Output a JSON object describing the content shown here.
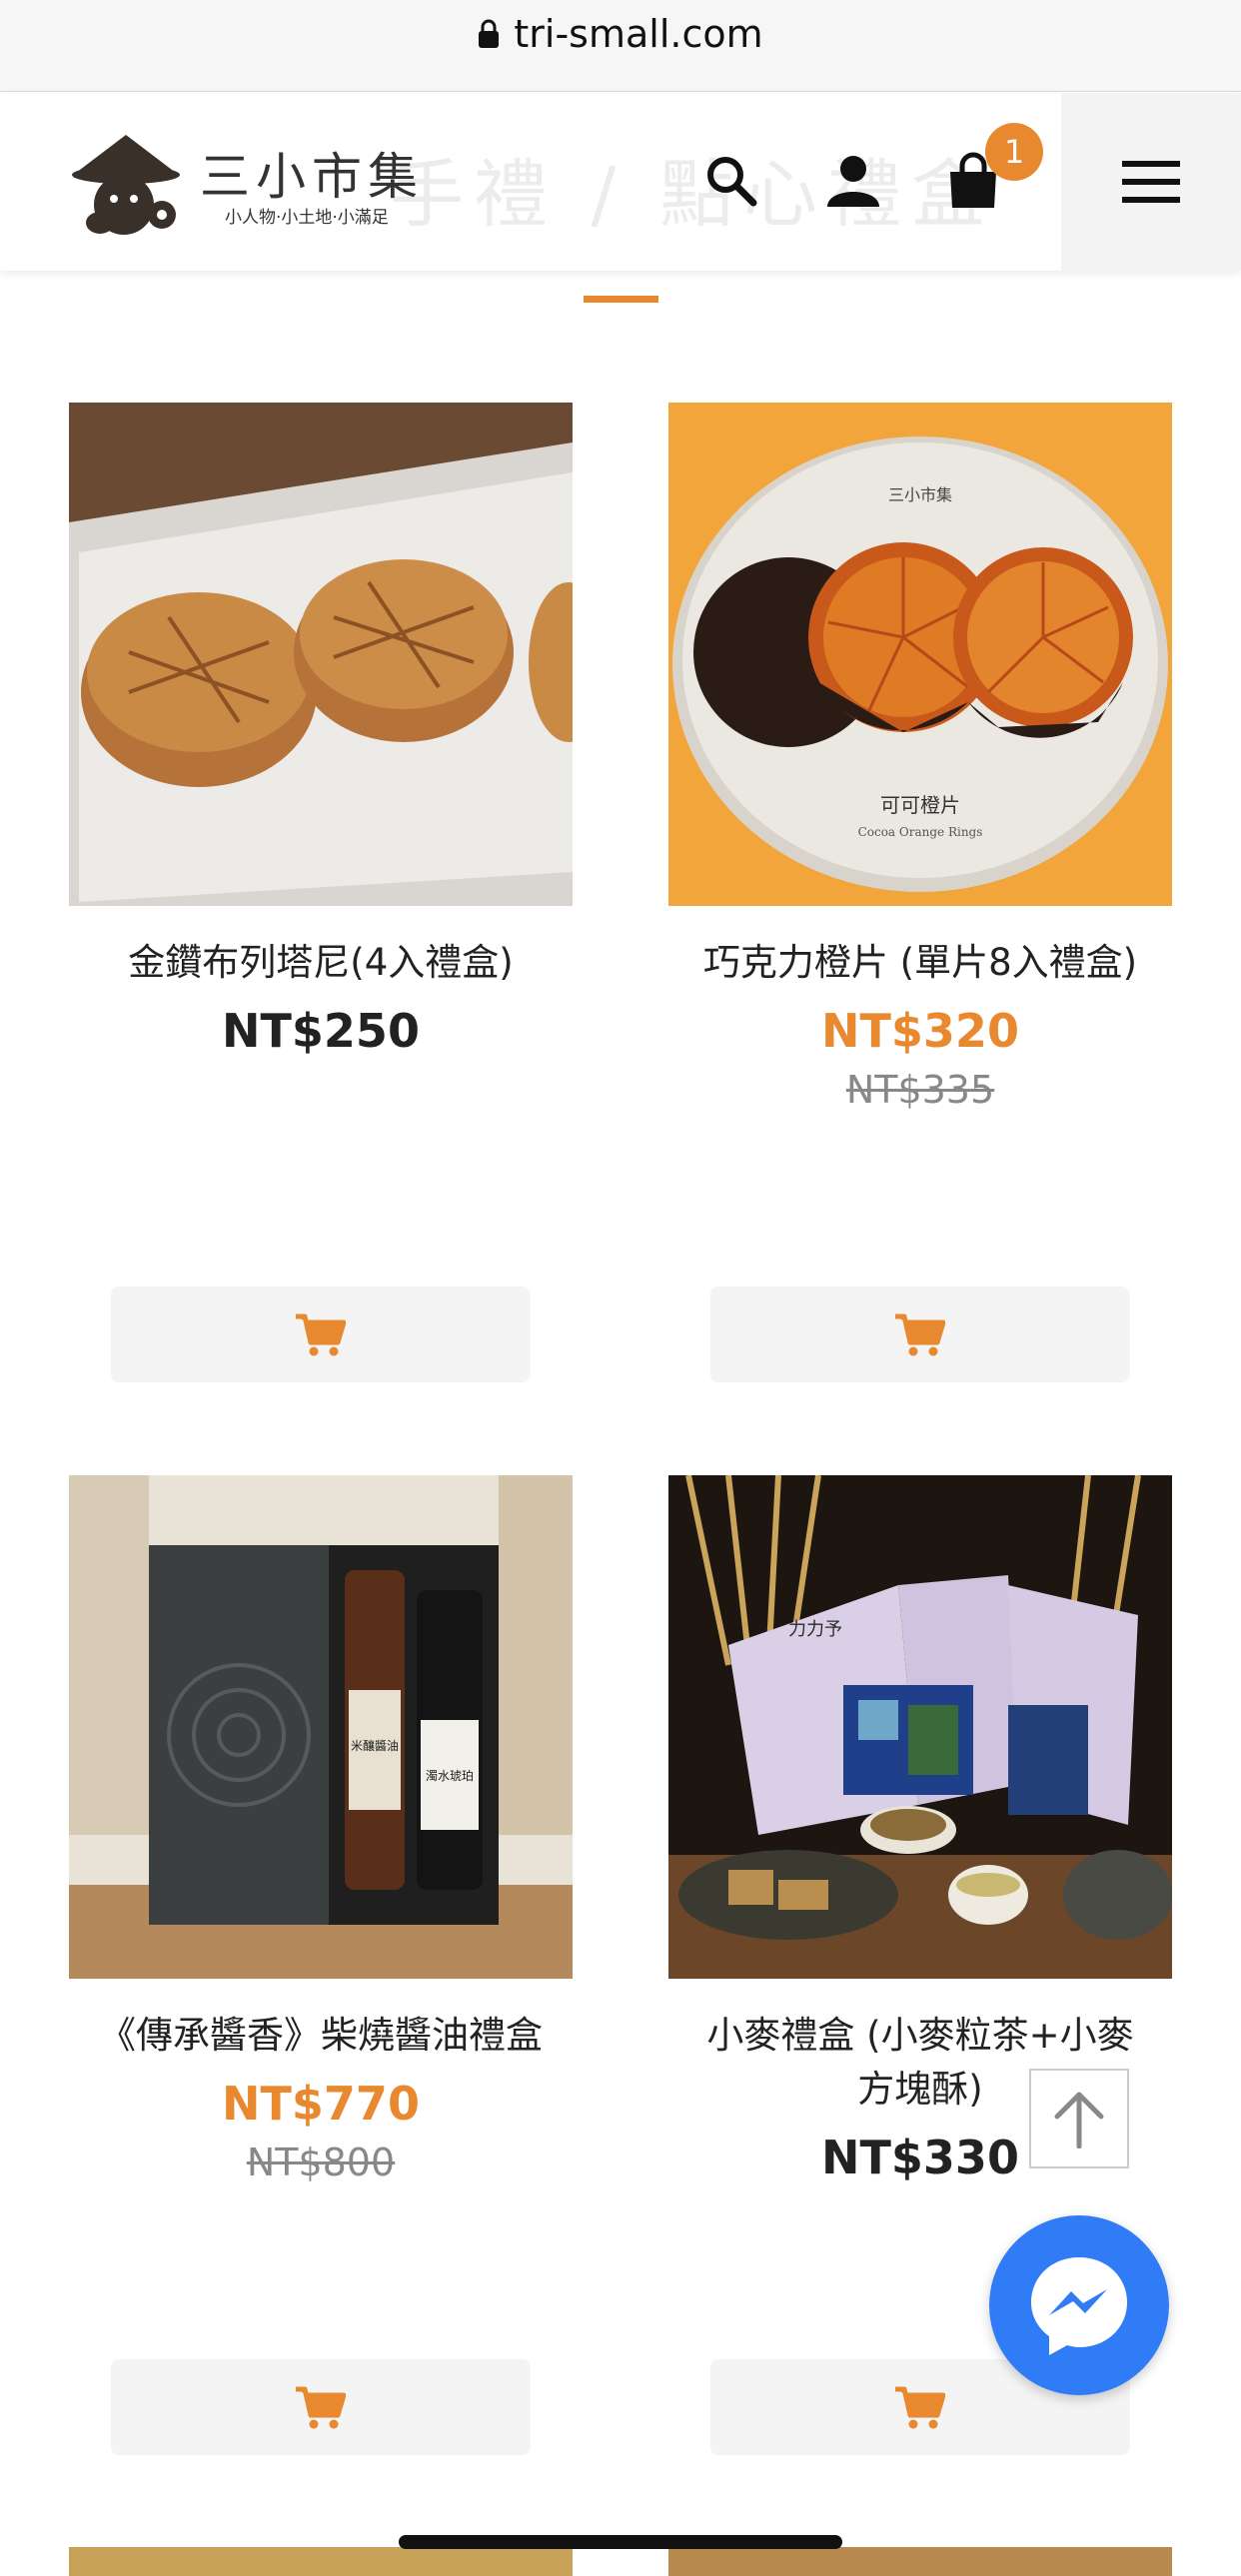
{
  "browser": {
    "url": "tri-small.com",
    "lock_icon": "lock-icon"
  },
  "header": {
    "brand_name": "三小市集",
    "brand_tagline": "小人物·小土地·小滿足",
    "ghost_title": "手禮 / 點心禮盒",
    "icons": [
      "search-icon",
      "user-icon",
      "shopping-bag-icon",
      "hamburger-menu-icon"
    ],
    "cart_count": "1"
  },
  "colors": {
    "accent": "#e8892f",
    "text": "#222222",
    "muted": "#888888",
    "button_bg": "#f4f4f4",
    "messenger": "#2f7cf6"
  },
  "products": [
    {
      "name": "金鑽布列塔尼(4入禮盒)",
      "price": "NT$250",
      "original_price": "",
      "on_sale": false
    },
    {
      "name": "巧克力橙片 (單片8入禮盒)",
      "price": "NT$320",
      "original_price": "NT$335",
      "on_sale": true,
      "image_text": {
        "brand": "三小市集",
        "title": "可可橙片",
        "subtitle": "Cocoa Orange Rings"
      }
    },
    {
      "name": "《傳承醬香》柴燒醬油禮盒",
      "price": "NT$770",
      "original_price": "NT$800",
      "on_sale": true,
      "image_text": {
        "label_a": "米釀醬油",
        "label_b": "濁水琥珀"
      }
    },
    {
      "name": "小麥禮盒 (小麥粒茶+小麥方塊酥)",
      "price": "NT$330",
      "original_price": "",
      "on_sale": false,
      "image_text": {
        "label": "力力予"
      }
    }
  ],
  "actions": {
    "add_to_cart_icon": "cart-icon",
    "back_to_top_icon": "arrow-up-icon",
    "messenger_icon": "messenger-icon"
  }
}
